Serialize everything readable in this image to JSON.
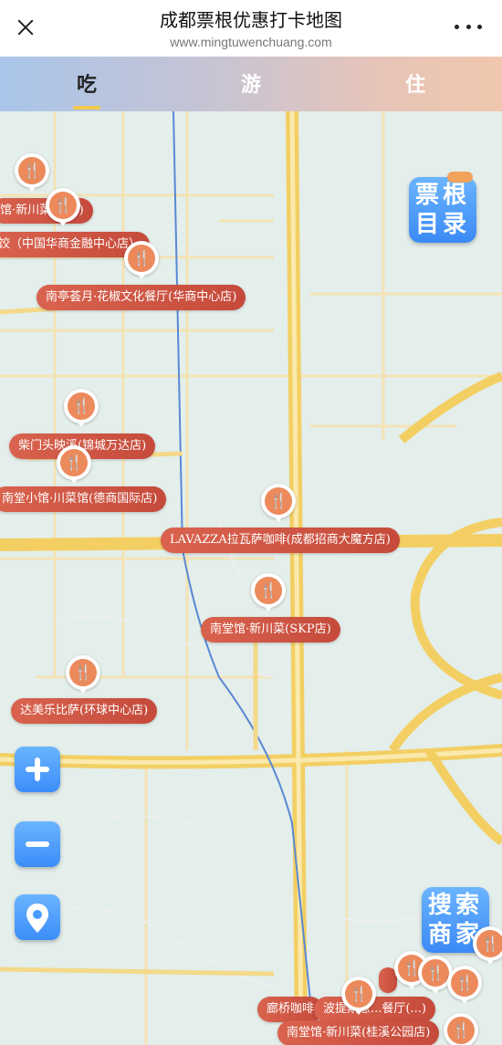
{
  "header": {
    "title": "成都票根优惠打卡地图",
    "url": "www.mingtuwenchuang.com"
  },
  "tabs": [
    {
      "label": "吃",
      "active": true
    },
    {
      "label": "游",
      "active": false
    },
    {
      "label": "住",
      "active": false
    }
  ],
  "badges": {
    "catalog": {
      "line1": "票根",
      "line2": "目录"
    },
    "search": {
      "line1": "搜索",
      "line2": "商家"
    }
  },
  "places": [
    {
      "label": "馆·新川菜(...店)",
      "icon": "fork-knife-icon"
    },
    {
      "label": "饺（中国华商金融中心店）",
      "icon": "fork-knife-icon"
    },
    {
      "label": "南亭荟月·花椒文化餐厅(华商中心店)",
      "icon": "fork-knife-icon"
    },
    {
      "label": "柴门头映溪(锦城万达店)",
      "icon": "fork-knife-icon"
    },
    {
      "label": "南堂小馆·川菜馆(德商国际店)",
      "icon": "fork-knife-icon"
    },
    {
      "label": "LAVAZZA拉瓦萨咖啡(成都招商大魔方店)",
      "icon": "fork-knife-icon"
    },
    {
      "label": "南堂馆·新川菜(SKP店)",
      "icon": "fork-knife-icon"
    },
    {
      "label": "达美乐比萨(环球中心店)",
      "icon": "fork-knife-icon"
    },
    {
      "label": "廊桥咖啡",
      "icon": "fork-knife-icon"
    },
    {
      "label": "波提斯意...餐厅(...)",
      "icon": "fork-knife-icon"
    },
    {
      "label": "南堂馆·新川菜(桂溪公园店)",
      "icon": "fork-knife-icon"
    }
  ],
  "colors": {
    "label_bg": "#d0553f",
    "marker": "#ec8a5c",
    "control": "#4a9bff",
    "road_major": "#f5d36b"
  }
}
